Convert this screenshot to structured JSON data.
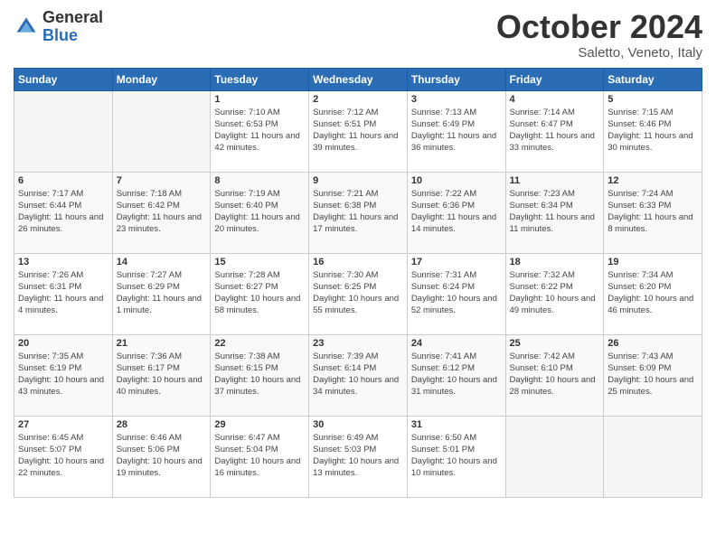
{
  "header": {
    "logo_general": "General",
    "logo_blue": "Blue",
    "title": "October 2024",
    "location": "Saletto, Veneto, Italy"
  },
  "days_of_week": [
    "Sunday",
    "Monday",
    "Tuesday",
    "Wednesday",
    "Thursday",
    "Friday",
    "Saturday"
  ],
  "weeks": [
    [
      {
        "day": "",
        "sunrise": "",
        "sunset": "",
        "daylight": ""
      },
      {
        "day": "",
        "sunrise": "",
        "sunset": "",
        "daylight": ""
      },
      {
        "day": "1",
        "sunrise": "Sunrise: 7:10 AM",
        "sunset": "Sunset: 6:53 PM",
        "daylight": "Daylight: 11 hours and 42 minutes."
      },
      {
        "day": "2",
        "sunrise": "Sunrise: 7:12 AM",
        "sunset": "Sunset: 6:51 PM",
        "daylight": "Daylight: 11 hours and 39 minutes."
      },
      {
        "day": "3",
        "sunrise": "Sunrise: 7:13 AM",
        "sunset": "Sunset: 6:49 PM",
        "daylight": "Daylight: 11 hours and 36 minutes."
      },
      {
        "day": "4",
        "sunrise": "Sunrise: 7:14 AM",
        "sunset": "Sunset: 6:47 PM",
        "daylight": "Daylight: 11 hours and 33 minutes."
      },
      {
        "day": "5",
        "sunrise": "Sunrise: 7:15 AM",
        "sunset": "Sunset: 6:46 PM",
        "daylight": "Daylight: 11 hours and 30 minutes."
      }
    ],
    [
      {
        "day": "6",
        "sunrise": "Sunrise: 7:17 AM",
        "sunset": "Sunset: 6:44 PM",
        "daylight": "Daylight: 11 hours and 26 minutes."
      },
      {
        "day": "7",
        "sunrise": "Sunrise: 7:18 AM",
        "sunset": "Sunset: 6:42 PM",
        "daylight": "Daylight: 11 hours and 23 minutes."
      },
      {
        "day": "8",
        "sunrise": "Sunrise: 7:19 AM",
        "sunset": "Sunset: 6:40 PM",
        "daylight": "Daylight: 11 hours and 20 minutes."
      },
      {
        "day": "9",
        "sunrise": "Sunrise: 7:21 AM",
        "sunset": "Sunset: 6:38 PM",
        "daylight": "Daylight: 11 hours and 17 minutes."
      },
      {
        "day": "10",
        "sunrise": "Sunrise: 7:22 AM",
        "sunset": "Sunset: 6:36 PM",
        "daylight": "Daylight: 11 hours and 14 minutes."
      },
      {
        "day": "11",
        "sunrise": "Sunrise: 7:23 AM",
        "sunset": "Sunset: 6:34 PM",
        "daylight": "Daylight: 11 hours and 11 minutes."
      },
      {
        "day": "12",
        "sunrise": "Sunrise: 7:24 AM",
        "sunset": "Sunset: 6:33 PM",
        "daylight": "Daylight: 11 hours and 8 minutes."
      }
    ],
    [
      {
        "day": "13",
        "sunrise": "Sunrise: 7:26 AM",
        "sunset": "Sunset: 6:31 PM",
        "daylight": "Daylight: 11 hours and 4 minutes."
      },
      {
        "day": "14",
        "sunrise": "Sunrise: 7:27 AM",
        "sunset": "Sunset: 6:29 PM",
        "daylight": "Daylight: 11 hours and 1 minute."
      },
      {
        "day": "15",
        "sunrise": "Sunrise: 7:28 AM",
        "sunset": "Sunset: 6:27 PM",
        "daylight": "Daylight: 10 hours and 58 minutes."
      },
      {
        "day": "16",
        "sunrise": "Sunrise: 7:30 AM",
        "sunset": "Sunset: 6:25 PM",
        "daylight": "Daylight: 10 hours and 55 minutes."
      },
      {
        "day": "17",
        "sunrise": "Sunrise: 7:31 AM",
        "sunset": "Sunset: 6:24 PM",
        "daylight": "Daylight: 10 hours and 52 minutes."
      },
      {
        "day": "18",
        "sunrise": "Sunrise: 7:32 AM",
        "sunset": "Sunset: 6:22 PM",
        "daylight": "Daylight: 10 hours and 49 minutes."
      },
      {
        "day": "19",
        "sunrise": "Sunrise: 7:34 AM",
        "sunset": "Sunset: 6:20 PM",
        "daylight": "Daylight: 10 hours and 46 minutes."
      }
    ],
    [
      {
        "day": "20",
        "sunrise": "Sunrise: 7:35 AM",
        "sunset": "Sunset: 6:19 PM",
        "daylight": "Daylight: 10 hours and 43 minutes."
      },
      {
        "day": "21",
        "sunrise": "Sunrise: 7:36 AM",
        "sunset": "Sunset: 6:17 PM",
        "daylight": "Daylight: 10 hours and 40 minutes."
      },
      {
        "day": "22",
        "sunrise": "Sunrise: 7:38 AM",
        "sunset": "Sunset: 6:15 PM",
        "daylight": "Daylight: 10 hours and 37 minutes."
      },
      {
        "day": "23",
        "sunrise": "Sunrise: 7:39 AM",
        "sunset": "Sunset: 6:14 PM",
        "daylight": "Daylight: 10 hours and 34 minutes."
      },
      {
        "day": "24",
        "sunrise": "Sunrise: 7:41 AM",
        "sunset": "Sunset: 6:12 PM",
        "daylight": "Daylight: 10 hours and 31 minutes."
      },
      {
        "day": "25",
        "sunrise": "Sunrise: 7:42 AM",
        "sunset": "Sunset: 6:10 PM",
        "daylight": "Daylight: 10 hours and 28 minutes."
      },
      {
        "day": "26",
        "sunrise": "Sunrise: 7:43 AM",
        "sunset": "Sunset: 6:09 PM",
        "daylight": "Daylight: 10 hours and 25 minutes."
      }
    ],
    [
      {
        "day": "27",
        "sunrise": "Sunrise: 6:45 AM",
        "sunset": "Sunset: 5:07 PM",
        "daylight": "Daylight: 10 hours and 22 minutes."
      },
      {
        "day": "28",
        "sunrise": "Sunrise: 6:46 AM",
        "sunset": "Sunset: 5:06 PM",
        "daylight": "Daylight: 10 hours and 19 minutes."
      },
      {
        "day": "29",
        "sunrise": "Sunrise: 6:47 AM",
        "sunset": "Sunset: 5:04 PM",
        "daylight": "Daylight: 10 hours and 16 minutes."
      },
      {
        "day": "30",
        "sunrise": "Sunrise: 6:49 AM",
        "sunset": "Sunset: 5:03 PM",
        "daylight": "Daylight: 10 hours and 13 minutes."
      },
      {
        "day": "31",
        "sunrise": "Sunrise: 6:50 AM",
        "sunset": "Sunset: 5:01 PM",
        "daylight": "Daylight: 10 hours and 10 minutes."
      },
      {
        "day": "",
        "sunrise": "",
        "sunset": "",
        "daylight": ""
      },
      {
        "day": "",
        "sunrise": "",
        "sunset": "",
        "daylight": ""
      }
    ]
  ]
}
